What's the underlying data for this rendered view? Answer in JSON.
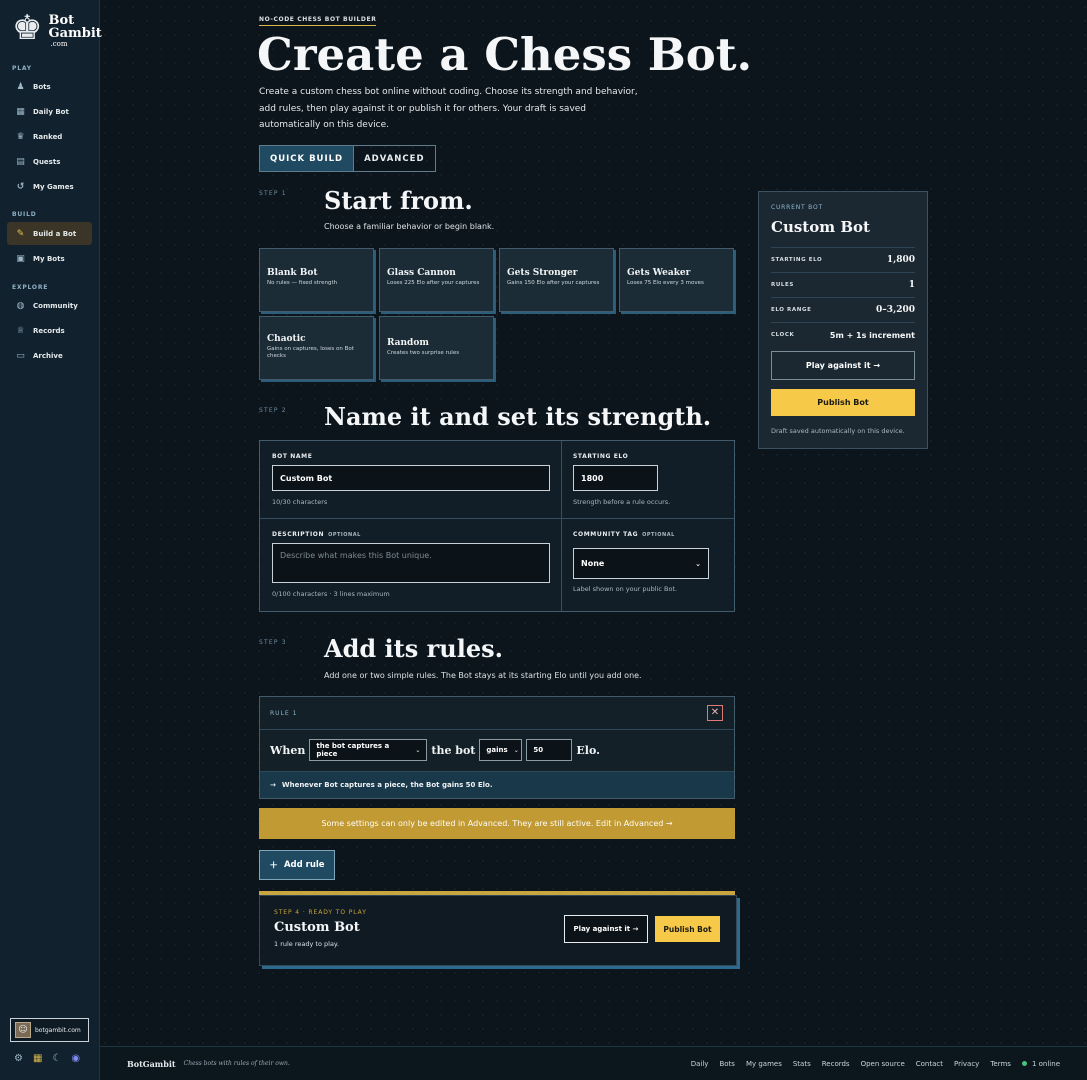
{
  "brand": {
    "name": "Bot Gambit",
    "line1": "Bot",
    "line2": "Gambit",
    "domain": ".com",
    "logo_icon": "chess-king-icon"
  },
  "sidebar": {
    "sections": [
      {
        "label": "PLAY"
      },
      {
        "label": "BUILD"
      },
      {
        "label": "EXPLORE"
      }
    ],
    "items": [
      {
        "label": "Bots",
        "icon": "pawn-icon"
      },
      {
        "label": "Daily Bot",
        "icon": "calendar-icon"
      },
      {
        "label": "Ranked",
        "icon": "trophy-icon"
      },
      {
        "label": "Quests",
        "icon": "scroll-icon"
      },
      {
        "label": "My Games",
        "icon": "history-icon"
      },
      {
        "label": "Build a Bot",
        "icon": "wrench-icon",
        "active": true
      },
      {
        "label": "My Bots",
        "icon": "robot-icon"
      },
      {
        "label": "Community",
        "icon": "globe-icon"
      },
      {
        "label": "Records",
        "icon": "trophy-icon"
      },
      {
        "label": "Archive",
        "icon": "archive-icon"
      }
    ],
    "site_chip": "botgambit.com",
    "bottom_icons": [
      "settings-icon",
      "board-icon",
      "moon-icon",
      "discord-icon"
    ]
  },
  "header": {
    "eyebrow": "NO-CODE CHESS BOT BUILDER",
    "title": "Create a Chess Bot.",
    "intro": "Create a custom chess bot online without coding. Choose its strength and behavior, add rules, then play against it or publish it for others. Your draft is saved automatically on this device."
  },
  "tabs": [
    {
      "label": "QUICK BUILD",
      "active": true
    },
    {
      "label": "ADVANCED",
      "active": false
    }
  ],
  "step1": {
    "label": "STEP 1",
    "title": "Start from.",
    "subtitle": "Choose a familiar behavior or begin blank.",
    "cards": [
      {
        "title": "Blank Bot",
        "desc": "No rules — fixed strength"
      },
      {
        "title": "Glass Cannon",
        "desc": "Loses 225 Elo after your captures"
      },
      {
        "title": "Gets Stronger",
        "desc": "Gains 150 Elo after your captures"
      },
      {
        "title": "Gets Weaker",
        "desc": "Loses 75 Elo every 3 moves"
      },
      {
        "title": "Chaotic",
        "desc": "Gains on captures, loses on Bot checks"
      },
      {
        "title": "Random",
        "desc": "Creates two surprise rules"
      }
    ]
  },
  "step2": {
    "label": "STEP 2",
    "title": "Name it and set its strength.",
    "bot_name": {
      "label": "BOT NAME",
      "value": "Custom Bot",
      "hint": "10/30 characters"
    },
    "starting_elo": {
      "label": "STARTING ELO",
      "value": "1800",
      "hint": "Strength before a rule occurs."
    },
    "description": {
      "label": "DESCRIPTION",
      "optional": "OPTIONAL",
      "placeholder": "Describe what makes this Bot unique.",
      "hint": "0/100 characters · 3 lines maximum"
    },
    "community_tag": {
      "label": "COMMUNITY TAG",
      "optional": "OPTIONAL",
      "value": "None",
      "hint": "Label shown on your public Bot."
    }
  },
  "step3": {
    "label": "STEP 3",
    "title": "Add its rules.",
    "subtitle": "Add one or two simple rules. The Bot stays at its starting Elo until you add one.",
    "rule": {
      "label": "RULE 1",
      "when": "When",
      "trigger": "the bot captures a piece",
      "the_bot": "the bot",
      "direction": "gains",
      "amount": "50",
      "unit": "Elo.",
      "summary": "Whenever Bot captures a piece, the Bot gains 50 Elo."
    },
    "warning": "Some settings can only be edited in Advanced. They are still active. Edit in Advanced →",
    "add_rule": "Add rule"
  },
  "step4": {
    "label": "STEP 4 · READY TO PLAY",
    "name": "Custom Bot",
    "count": "1 rule ready to play.",
    "play": "Play against it →",
    "publish": "Publish Bot"
  },
  "current_bot": {
    "label": "CURRENT BOT",
    "name": "Custom Bot",
    "rows": [
      {
        "key": "STARTING ELO",
        "value": "1,800"
      },
      {
        "key": "RULES",
        "value": "1"
      },
      {
        "key": "ELO RANGE",
        "value": "0–3,200"
      },
      {
        "key": "CLOCK",
        "value": "5m + 1s increment"
      }
    ],
    "play": "Play against it →",
    "publish": "Publish Bot",
    "draft": "Draft saved automatically on this device."
  },
  "footer": {
    "brand": "BotGambit",
    "tagline": "Chess bots with rules of their own.",
    "links": [
      "Daily",
      "Bots",
      "My games",
      "Stats",
      "Records",
      "Open source",
      "Contact",
      "Privacy",
      "Terms"
    ],
    "online": "1 online"
  },
  "colors": {
    "accent": "#f7c948",
    "tab_active": "#1f4a62",
    "warning": "#c19a34",
    "background": "#0c151c"
  }
}
